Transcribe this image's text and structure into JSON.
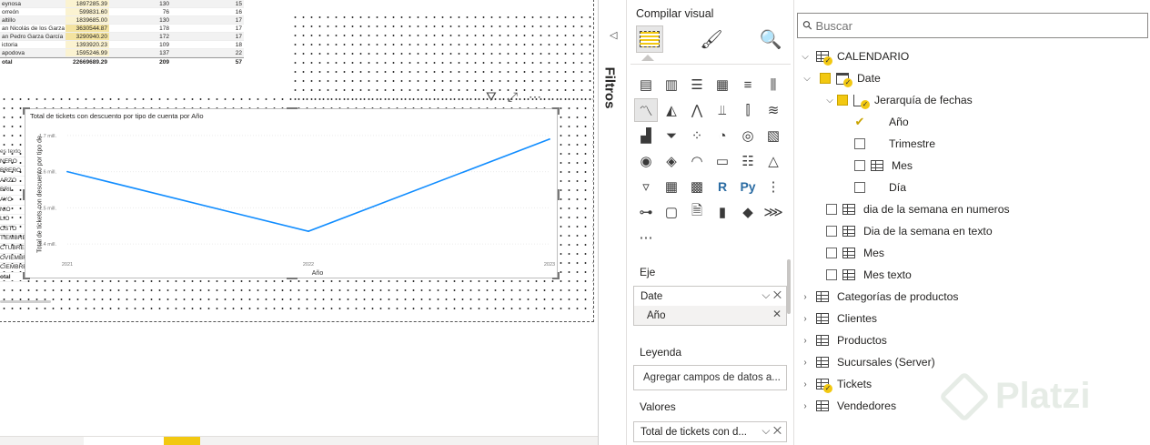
{
  "top_table": {
    "rows": [
      {
        "name": "eynosa",
        "v1": "1897285.39",
        "v2": "130",
        "v3": "15",
        "hl": false
      },
      {
        "name": "orreón",
        "v1": "599831.60",
        "v2": "76",
        "v3": "16",
        "hl": false
      },
      {
        "name": "altillo",
        "v1": "1839685.00",
        "v2": "130",
        "v3": "17",
        "hl": false
      },
      {
        "name": "an Nicolás de los Garza",
        "v1": "3630544.87",
        "v2": "178",
        "v3": "17",
        "hl": true
      },
      {
        "name": "an Pedro Garza García",
        "v1": "3290940.20",
        "v2": "172",
        "v3": "17",
        "hl": true
      },
      {
        "name": "ictoria",
        "v1": "1393920.23",
        "v2": "109",
        "v3": "18",
        "hl": false
      },
      {
        "name": "apodova",
        "v1": "1595246.99",
        "v2": "137",
        "v3": "22",
        "hl": false
      }
    ],
    "total": {
      "label": "otal",
      "v1": "22669689.29",
      "v2": "209",
      "v3": "57"
    }
  },
  "left_matrix": {
    "header": "es texto",
    "rows": [
      "NERO",
      "BRERO",
      "ARZO",
      "BRIL",
      "AYO",
      "NIO",
      "LIO",
      "OSTO",
      "TIEMBRE",
      "CTUBRE",
      "OVIEMBRE",
      "CIEMBRE"
    ],
    "total": "otal"
  },
  "chart_data": {
    "type": "line",
    "title": "Total de tickets con descuento por tipo de cuenta por Año",
    "xlabel": "Año",
    "ylabel": "Total de tickets con descuento por tipo de",
    "x": [
      "2021",
      "2022",
      "2023"
    ],
    "series": [
      {
        "values": [
          1.6,
          1.435,
          1.69
        ]
      }
    ],
    "yticks": [
      "1.4 mill.",
      "1.5 mill.",
      "1.6 mill.",
      "1.7 mill."
    ],
    "ylim": [
      1.37,
      1.73
    ],
    "line_color": "#118DFF"
  },
  "visual_header": {
    "icons": [
      "filter-icon",
      "focus-mode-icon",
      "more-options-icon"
    ]
  },
  "filters_pane": {
    "label": "Filtros"
  },
  "visualizations": {
    "title": "Compilar visual",
    "icons": [
      "stacked-bar-icon",
      "stacked-column-icon",
      "clustered-bar-icon",
      "clustered-column-icon",
      "100-stacked-bar-icon",
      "100-stacked-column-icon",
      "line-chart-icon",
      "area-chart-icon",
      "stacked-area-icon",
      "line-stacked-column-icon",
      "line-clustered-column-icon",
      "ribbon-chart-icon",
      "waterfall-icon",
      "funnel-icon",
      "scatter-icon",
      "pie-chart-icon",
      "donut-chart-icon",
      "treemap-icon",
      "map-icon",
      "filled-map-icon",
      "gauge-icon",
      "card-icon",
      "multi-row-card-icon",
      "kpi-icon",
      "slicer-icon",
      "table-icon",
      "matrix-icon",
      "r-visual-icon",
      "python-visual-icon",
      "key-influencers-icon",
      "decomposition-tree-icon",
      "qa-icon",
      "smart-narrative-icon",
      "paginated-report-icon",
      "power-apps-icon",
      "power-automate-icon",
      "more-visuals-icon"
    ],
    "python_label": "Py",
    "r_label": "R",
    "wells": {
      "axis": {
        "label": "Eje",
        "field": "Date",
        "sub_field": "Año"
      },
      "legend": {
        "label": "Leyenda",
        "placeholder": "Agregar campos de datos a..."
      },
      "values": {
        "label": "Valores",
        "field": "Total de tickets con d..."
      }
    }
  },
  "fields": {
    "search_placeholder": "Buscar",
    "tree": [
      {
        "label": "CALENDARIO",
        "level": 0,
        "chevron": "down",
        "icon": "calendar-table",
        "badge": true
      },
      {
        "label": "Date",
        "level": 1,
        "chevron": "down",
        "check": "on",
        "icon": "calendar",
        "badge": true
      },
      {
        "label": "Jerarquía de fechas",
        "level": 2,
        "chevron": "down",
        "check": "on",
        "icon": "hierarchy",
        "badge": true
      },
      {
        "label": "Año",
        "level": 3,
        "check": "tick"
      },
      {
        "label": "Trimestre",
        "level": 3,
        "check": "off"
      },
      {
        "label": "Mes",
        "level": 3,
        "check": "off",
        "icon": "calendar-table"
      },
      {
        "label": "Día",
        "level": 3,
        "check": "off"
      },
      {
        "label": "dia de la semana en numeros",
        "level": 2,
        "check": "off",
        "icon": "calendar-table"
      },
      {
        "label": "Dia de la semana en texto",
        "level": 2,
        "check": "off",
        "icon": "calendar-table"
      },
      {
        "label": "Mes",
        "level": 2,
        "check": "off",
        "icon": "calendar-table"
      },
      {
        "label": "Mes texto",
        "level": 2,
        "check": "off",
        "icon": "calendar-table"
      },
      {
        "label": "Categorías de productos",
        "level": 0,
        "chevron": "right",
        "icon": "table"
      },
      {
        "label": "Clientes",
        "level": 0,
        "chevron": "right",
        "icon": "table"
      },
      {
        "label": "Productos",
        "level": 0,
        "chevron": "right",
        "icon": "table"
      },
      {
        "label": "Sucursales (Server)",
        "level": 0,
        "chevron": "right",
        "icon": "table"
      },
      {
        "label": "Tickets",
        "level": 0,
        "chevron": "right",
        "icon": "table",
        "badge": true
      },
      {
        "label": "Vendedores",
        "level": 0,
        "chevron": "right",
        "icon": "table"
      }
    ]
  },
  "watermark": {
    "text": "Platzi"
  }
}
